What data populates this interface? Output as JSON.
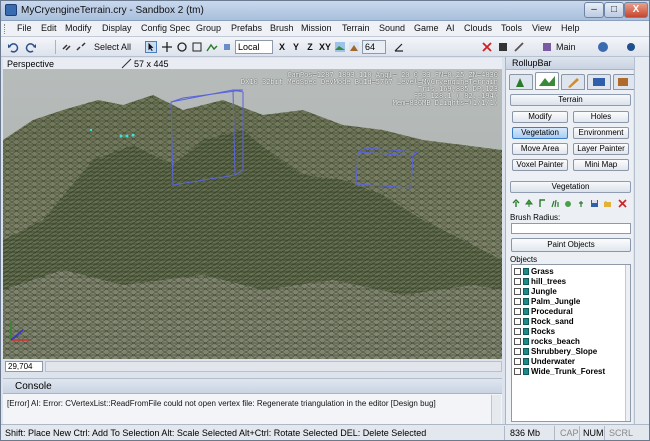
{
  "window": {
    "title": "MyCryengineTerrain.cry - Sandbox 2 (tm)",
    "controls": {
      "minimize": "–",
      "maximize": "□",
      "close": "X"
    }
  },
  "menu": [
    "File",
    "Edit",
    "Modify",
    "Display",
    "Config Spec",
    "Group",
    "Prefabs",
    "Brush",
    "Mission",
    "Terrain",
    "Sound",
    "Game",
    "AI",
    "Clouds",
    "Tools",
    "View",
    "Help"
  ],
  "toolbar": {
    "select_mode": "Select All",
    "coord_system": "Local",
    "axes": [
      "X",
      "Y",
      "Z",
      "XY"
    ],
    "grid_value": "64",
    "layer": "Main"
  },
  "viewport": {
    "name": "Perspective",
    "resolution": "57 x 445",
    "hud": [
      "CamPos=1287 1893 110 Angl= 20  0  33 FN=0.25 ZN=4830",
      "DX10 32bit MedSpec DevMode BuId=5767 Level=MyCryengineTerrain",
      "Tris:169,835 DP:123",
      "FPS 128.1 ( 82..194)",
      "Mem=836MB DLights=(1/1/1)"
    ],
    "coord_readout": "29,704"
  },
  "console": {
    "title": "Console",
    "message": "[Error] AI: Error: CVertexList::ReadFromFile could not open vertex file: Regenerate triangulation in the editor [Design bug]"
  },
  "statusbar": {
    "hint": "Shift: Place New  Ctrl: Add To Selection  Alt: Scale Selected  Alt+Ctrl: Rotate Selected DEL: Delete Selected",
    "memory": "836 Mb",
    "cap": "CAP",
    "num": "NUM",
    "scrl": "SCRL"
  },
  "rollup": {
    "title": "RollupBar",
    "terrain_panel": "Terrain",
    "buttons": [
      "Modify",
      "Holes",
      "Vegetation",
      "Environment",
      "Move Area",
      "Layer Painter",
      "Voxel Painter",
      "Mini Map"
    ],
    "vegetation_panel": "Vegetation",
    "brush_radius_label": "Brush Radius:",
    "paint_button": "Paint Objects",
    "objects_label": "Objects",
    "objects": [
      "Grass",
      "hill_trees",
      "Jungle",
      "Palm_Jungle",
      "Procedural",
      "Rock_sand",
      "Rocks",
      "rocks_beach",
      "Shrubbery_Slope",
      "Underwater",
      "Wide_Trunk_Forest"
    ]
  },
  "colors": {
    "active_button": "#a9cdf3",
    "terrain_wire": "#2c3a1f",
    "selection_box": "#5a64d8"
  }
}
